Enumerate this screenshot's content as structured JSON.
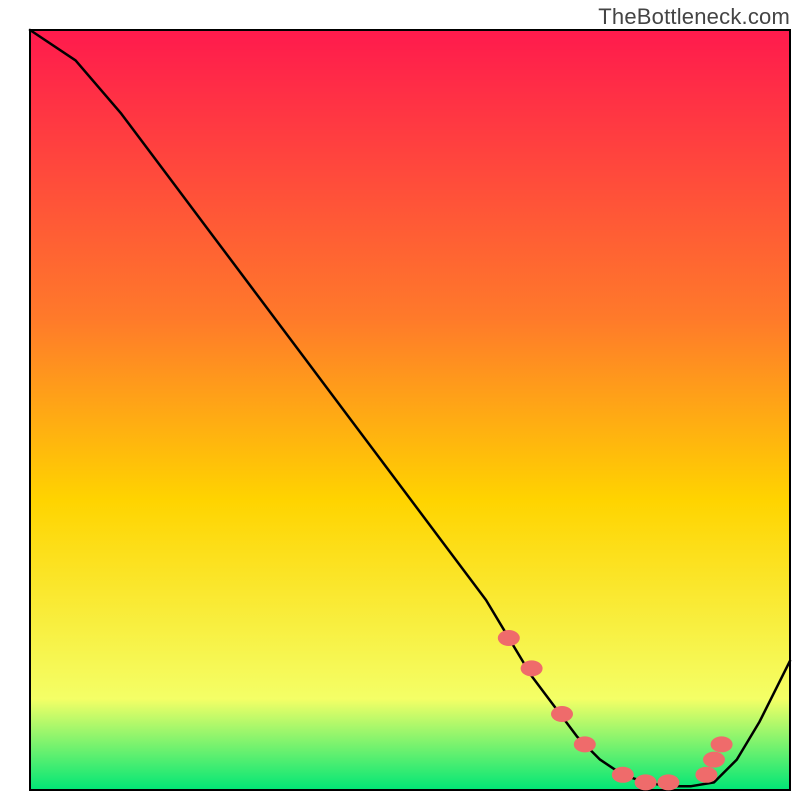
{
  "attribution": "TheBottleneck.com",
  "chart_data": {
    "type": "line",
    "title": "",
    "xlabel": "",
    "ylabel": "",
    "xlim": [
      0,
      100
    ],
    "ylim": [
      0,
      100
    ],
    "x": [
      0,
      6,
      12,
      18,
      24,
      30,
      36,
      42,
      48,
      54,
      60,
      63,
      66,
      69,
      72,
      75,
      78,
      81,
      84,
      87,
      90,
      93,
      96,
      100
    ],
    "values": [
      100,
      96,
      89,
      81,
      73,
      65,
      57,
      49,
      41,
      33,
      25,
      20,
      15,
      11,
      7,
      4,
      2,
      1,
      0.5,
      0.5,
      1,
      4,
      9,
      17
    ],
    "markers": {
      "x": [
        63,
        66,
        70,
        73,
        78,
        81,
        84,
        89,
        90,
        91
      ],
      "y": [
        20,
        16,
        10,
        6,
        2,
        1,
        1,
        2,
        4,
        6
      ]
    },
    "legend_present": false,
    "grid": false,
    "background_gradient": {
      "top_color": "#ff1a4d",
      "mid_color": "#ffd400",
      "bottom_color": "#00e676"
    }
  }
}
